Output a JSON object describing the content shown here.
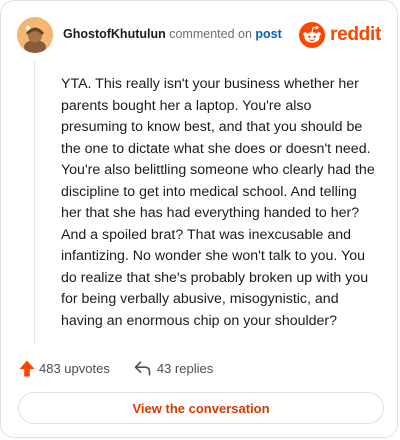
{
  "header": {
    "username": "GhostofKhutulun",
    "action_text": "commented on",
    "post_link": "post",
    "brand": "reddit"
  },
  "comment": {
    "body": "YTA. This really isn't your business whether her parents bought her a laptop. You're also presuming to know best, and that you should be the one to dictate what she does or doesn't need. You're also belittling someone who clearly had the discipline to get into medical school. And telling her that she has had everything handed to her? And a spoiled brat? That was inexcusable and infantizing. No wonder she won't talk to you. You do realize that she's probably broken up with you for being verbally abusive, misogynistic, and having an enormous chip on your shoulder?"
  },
  "actions": {
    "upvotes": "483 upvotes",
    "replies": "43 replies"
  },
  "footer": {
    "button_label": "View the conversation"
  },
  "icons": {
    "avatar": "avatar-icon",
    "brand": "reddit-logo-icon",
    "upvote": "upvote-arrow-icon",
    "reply": "reply-icon"
  },
  "colors": {
    "brand": "#ff4500",
    "link": "#0b5fb5",
    "button_text": "#d93a00",
    "avatar_bg": "#f3b773"
  }
}
